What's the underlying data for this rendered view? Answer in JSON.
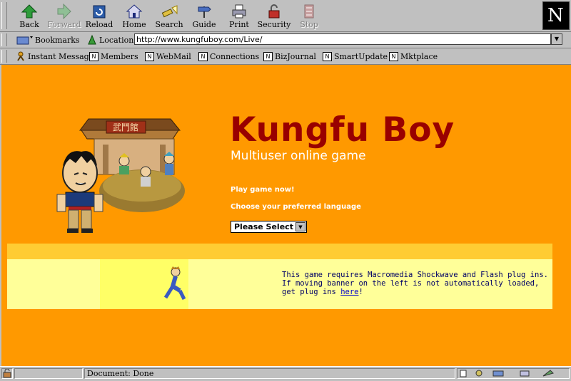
{
  "toolbar": {
    "back": "Back",
    "forward": "Forward",
    "reload": "Reload",
    "home": "Home",
    "search": "Search",
    "guide": "Guide",
    "print": "Print",
    "security": "Security",
    "stop": "Stop"
  },
  "location_bar": {
    "bookmarks": "Bookmarks",
    "location_label": "Location:",
    "url": "http://www.kungfuboy.com/Live/"
  },
  "personal_toolbar": [
    "Instant Message",
    "Members",
    "WebMail",
    "Connections",
    "BizJournal",
    "SmartUpdate",
    "Mktplace"
  ],
  "page": {
    "title": "Kungfu Boy",
    "subtitle": "Multiuser online game",
    "play_now": "Play game now!",
    "choose_language": "Choose your preferred language",
    "language_select": "Please Select",
    "sign_text": "武鬥館",
    "plugin_line1": "This game requires Macromedia Shockwave and Flash plug ins.",
    "plugin_line2": "If moving banner on the left is not automatically loaded, get plug ins ",
    "plugin_link": "here",
    "plugin_end": "!"
  },
  "status": {
    "text": "Document: Done"
  },
  "colors": {
    "background": "#ff9900",
    "title": "#990000",
    "band_top": "#ffcc33",
    "band_main": "#ffff99"
  }
}
